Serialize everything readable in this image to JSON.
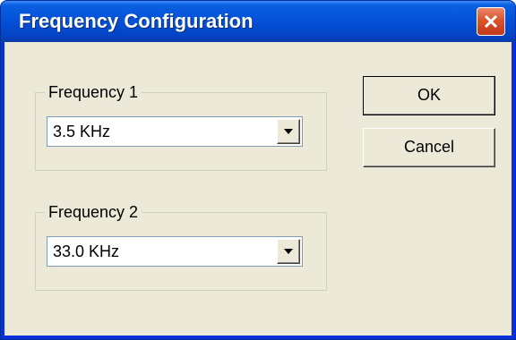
{
  "window": {
    "title": "Frequency Configuration"
  },
  "titlebar": {
    "close_icon": "close-icon"
  },
  "frequency1": {
    "label": "Frequency 1",
    "value": "3.5 KHz"
  },
  "frequency2": {
    "label": "Frequency 2",
    "value": "33.0 KHz"
  },
  "buttons": {
    "ok_label": "OK",
    "cancel_label": "Cancel"
  },
  "icons": {
    "dropdown": "chevron-down-icon"
  },
  "colors": {
    "titlebar": "#0450d8",
    "close": "#d9542a",
    "dialog_bg": "#ece9d8"
  }
}
